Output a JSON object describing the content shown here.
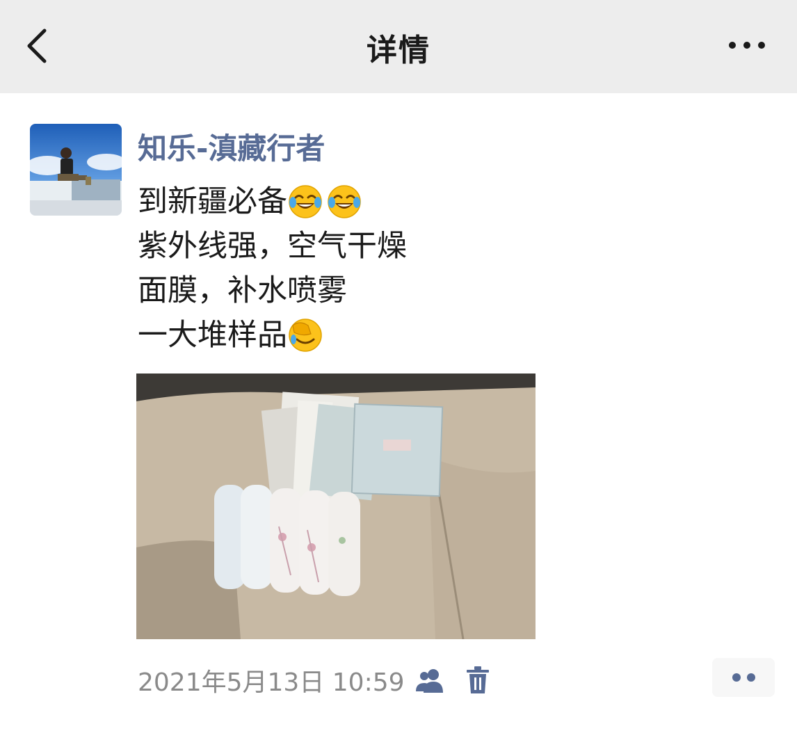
{
  "nav": {
    "title": "详情",
    "back_icon": "chevron-left-icon",
    "more_icon": "ellipsis-icon"
  },
  "post": {
    "author": "知乐-滇藏行者",
    "lines": [
      {
        "text": "到新疆必备",
        "emojis": [
          "tears-of-joy",
          "tears-of-joy"
        ]
      },
      {
        "text": "紫外线强，空气干燥",
        "emojis": []
      },
      {
        "text": "面膜，补水喷雾",
        "emojis": []
      },
      {
        "text": "一大堆样品",
        "emojis": [
          "facepalm"
        ]
      }
    ],
    "timestamp": "2021年5月13日 10:59",
    "visibility_icon": "friends-icon",
    "delete_icon": "trash-icon",
    "action_icon": "two-dots-icon"
  },
  "colors": {
    "nav_bg": "#ededed",
    "author": "#576b95",
    "text": "#1a1a1a",
    "meta": "#8a8a8a"
  }
}
